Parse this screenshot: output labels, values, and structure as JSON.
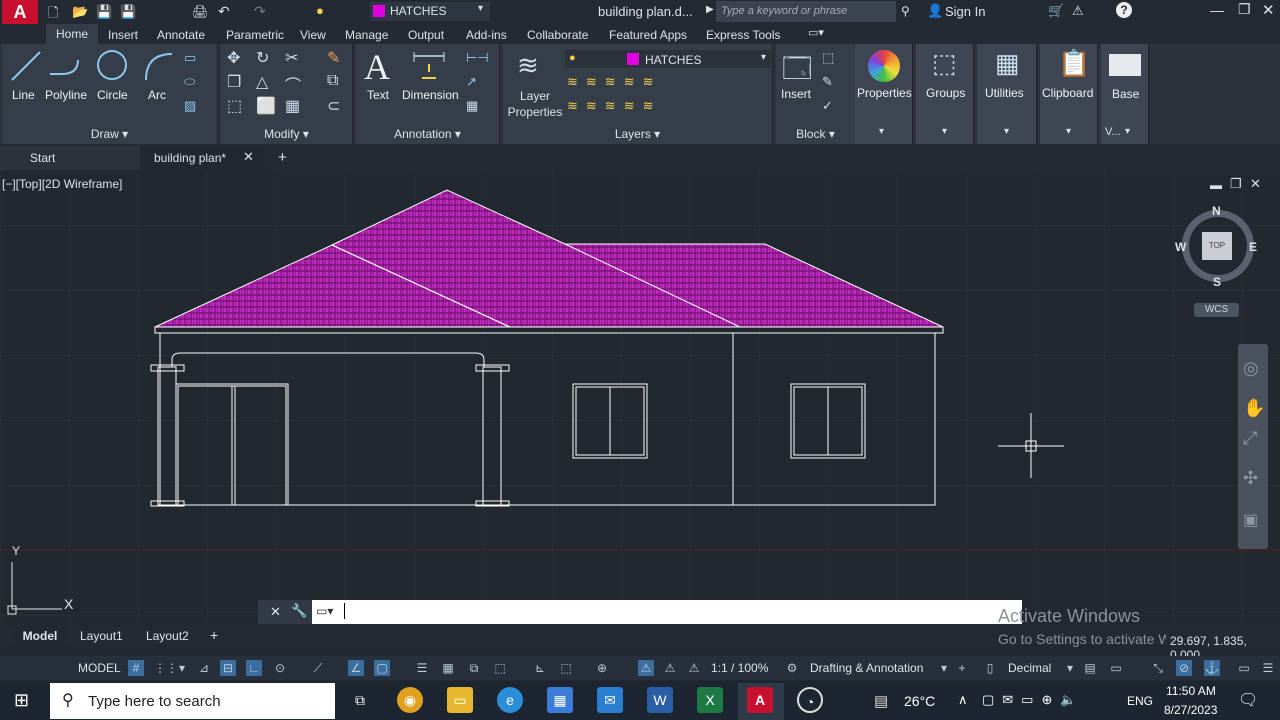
{
  "titlebar": {
    "layer_name": "HATCHES",
    "doc_title": "building plan.d...",
    "search_placeholder": "Type a keyword or phrase",
    "sign_in": "Sign In"
  },
  "menu_tabs": [
    "Home",
    "Insert",
    "Annotate",
    "Parametric",
    "View",
    "Manage",
    "Output",
    "Add-ins",
    "Collaborate",
    "Featured Apps",
    "Express Tools"
  ],
  "ribbon": {
    "draw": {
      "tools": [
        "Line",
        "Polyline",
        "Circle",
        "Arc"
      ],
      "label": "Draw ▾"
    },
    "modify": {
      "label": "Modify ▾"
    },
    "annotation": {
      "tools": [
        "Text",
        "Dimension"
      ],
      "label": "Annotation ▾"
    },
    "layers": {
      "tool": "Layer Properties",
      "layer_name": "HATCHES",
      "label": "Layers ▾"
    },
    "block": {
      "tool": "Insert",
      "label": "Block ▾"
    },
    "properties": {
      "label": "Properties"
    },
    "groups": {
      "label": "Groups"
    },
    "utilities": {
      "label": "Utilities"
    },
    "clipboard": {
      "label": "Clipboard"
    },
    "base": {
      "label": "Base",
      "sub": "V..."
    }
  },
  "doc_tabs": {
    "start": "Start",
    "active": "building plan*",
    "plus": "+"
  },
  "viewport": {
    "label": "[−][Top][2D Wireframe]",
    "viewcube": {
      "n": "N",
      "s": "S",
      "e": "E",
      "w": "W",
      "top": "TOP"
    },
    "wcs": "WCS",
    "ucs_y": "Y",
    "ucs_x": "X"
  },
  "watermark": {
    "line1": "Activate Windows",
    "line2": "Go to Settings to activate W..."
  },
  "coords": "29.697, 1.835, 0.000",
  "layout_tabs": [
    "Model",
    "Layout1",
    "Layout2"
  ],
  "status": {
    "model": "MODEL",
    "scale": "1:1 / 100%",
    "workspace": "Drafting & Annotation",
    "units": "Decimal"
  },
  "taskbar": {
    "search_placeholder": "Type here to search",
    "temperature": "26°C",
    "lang": "ENG",
    "time": "11:50 AM",
    "date": "8/27/2023"
  },
  "colors": {
    "hatch": "#c020c0",
    "accent": "#3b6e9e",
    "autocad_red": "#c8102e"
  }
}
